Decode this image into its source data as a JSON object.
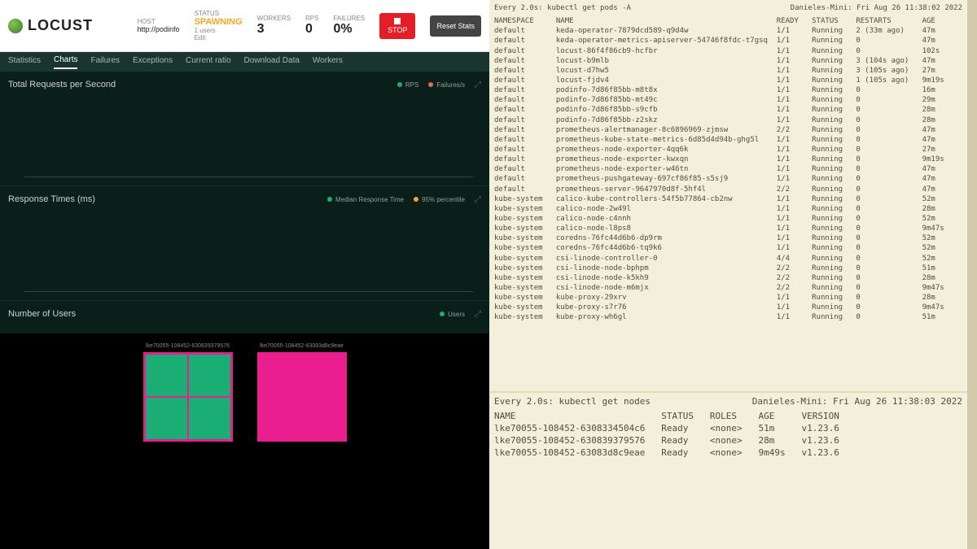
{
  "locust": {
    "logo": "LOCUST",
    "host_label": "HOST",
    "host_value": "http://podinfo",
    "status_label": "STATUS",
    "status_value": "SPAWNING",
    "status_sub": "1 users",
    "edit": "Edit",
    "workers_label": "WORKERS",
    "workers_value": "3",
    "rps_label": "RPS",
    "rps_value": "0",
    "failures_label": "FAILURES",
    "failures_value": "0%",
    "stop": "STOP",
    "reset": "Reset\nStats"
  },
  "tabs": [
    "Statistics",
    "Charts",
    "Failures",
    "Exceptions",
    "Current ratio",
    "Download Data",
    "Workers"
  ],
  "charts": {
    "rps": {
      "title": "Total Requests per Second",
      "legend_rps": "RPS",
      "legend_fail": "Failures/s"
    },
    "rt": {
      "title": "Response Times (ms)",
      "legend_med": "Median Response Time",
      "legend_p95": "95% percentile"
    },
    "users": {
      "title": "Number of Users",
      "legend": "Users"
    }
  },
  "grid": {
    "left_label": "lke70055-108452-630839379576",
    "right_label": "lke70055-108452-63083d8c9eae"
  },
  "term1": {
    "cmd": "Every 2.0s: kubectl get pods -A",
    "host": "Danieles-Mini: Fri Aug 26 11:38:02 2022",
    "cols": "NAMESPACE     NAME                                              READY   STATUS    RESTARTS       AGE",
    "rows": [
      "default       keda-operator-7879dcd589-q9d4w                    1/1     Running   2 (33m ago)    47m",
      "default       keda-operator-metrics-apiserver-54746f8fdc-t7gsq  1/1     Running   0              47m",
      "default       locust-86f4f86cb9-hcfbr                           1/1     Running   0              102s",
      "default       locust-b9mlb                                      1/1     Running   3 (104s ago)   47m",
      "default       locust-d7hw5                                      1/1     Running   3 (105s ago)   27m",
      "default       locust-fjdv4                                      1/1     Running   1 (105s ago)   9m19s",
      "default       podinfo-7d86f85bb-m8t8x                           1/1     Running   0              16m",
      "default       podinfo-7d86f85bb-mt49c                           1/1     Running   0              29m",
      "default       podinfo-7d86f85bb-s9cfb                           1/1     Running   0              28m",
      "default       podinfo-7d86f85bb-z2skz                           1/1     Running   0              28m",
      "default       prometheus-alertmanager-8c6896969-zjmsw           2/2     Running   0              47m",
      "default       prometheus-kube-state-metrics-6d85d4d94b-ghg5l    1/1     Running   0              47m",
      "default       prometheus-node-exporter-4qq6k                    1/1     Running   0              27m",
      "default       prometheus-node-exporter-kwxqn                    1/1     Running   0              9m19s",
      "default       prometheus-node-exporter-w46tn                    1/1     Running   0              47m",
      "default       prometheus-pushgateway-697cf86f85-s5sj9           1/1     Running   0              47m",
      "default       prometheus-server-9647970d8f-5hf4l                2/2     Running   0              47m",
      "kube-system   calico-kube-controllers-54f5b77864-cb2nw          1/1     Running   0              52m",
      "kube-system   calico-node-2w49l                                 1/1     Running   0              28m",
      "kube-system   calico-node-c4nnh                                 1/1     Running   0              52m",
      "kube-system   calico-node-l8ps8                                 1/1     Running   0              9m47s",
      "kube-system   coredns-76fc44d6b6-dp9rm                          1/1     Running   0              52m",
      "kube-system   coredns-76fc44d6b6-tq9k6                          1/1     Running   0              52m",
      "kube-system   csi-linode-controller-0                           4/4     Running   0              52m",
      "kube-system   csi-linode-node-bphpm                             2/2     Running   0              51m",
      "kube-system   csi-linode-node-k5kh9                             2/2     Running   0              28m",
      "kube-system   csi-linode-node-m6mjx                             2/2     Running   0              9m47s",
      "kube-system   kube-proxy-29xrv                                  1/1     Running   0              28m",
      "kube-system   kube-proxy-s7r76                                  1/1     Running   0              9m47s",
      "kube-system   kube-proxy-wh6gl                                  1/1     Running   0              51m"
    ]
  },
  "term2": {
    "cmd": "Every 2.0s: kubectl get nodes",
    "host": "Danieles-Mini: Fri Aug 26 11:38:03 2022",
    "cols": "NAME                           STATUS   ROLES    AGE     VERSION",
    "rows": [
      "lke70055-108452-6308334504c6   Ready    <none>   51m     v1.23.6",
      "lke70055-108452-630839379576   Ready    <none>   28m     v1.23.6",
      "lke70055-108452-63083d8c9eae   Ready    <none>   9m49s   v1.23.6"
    ]
  }
}
